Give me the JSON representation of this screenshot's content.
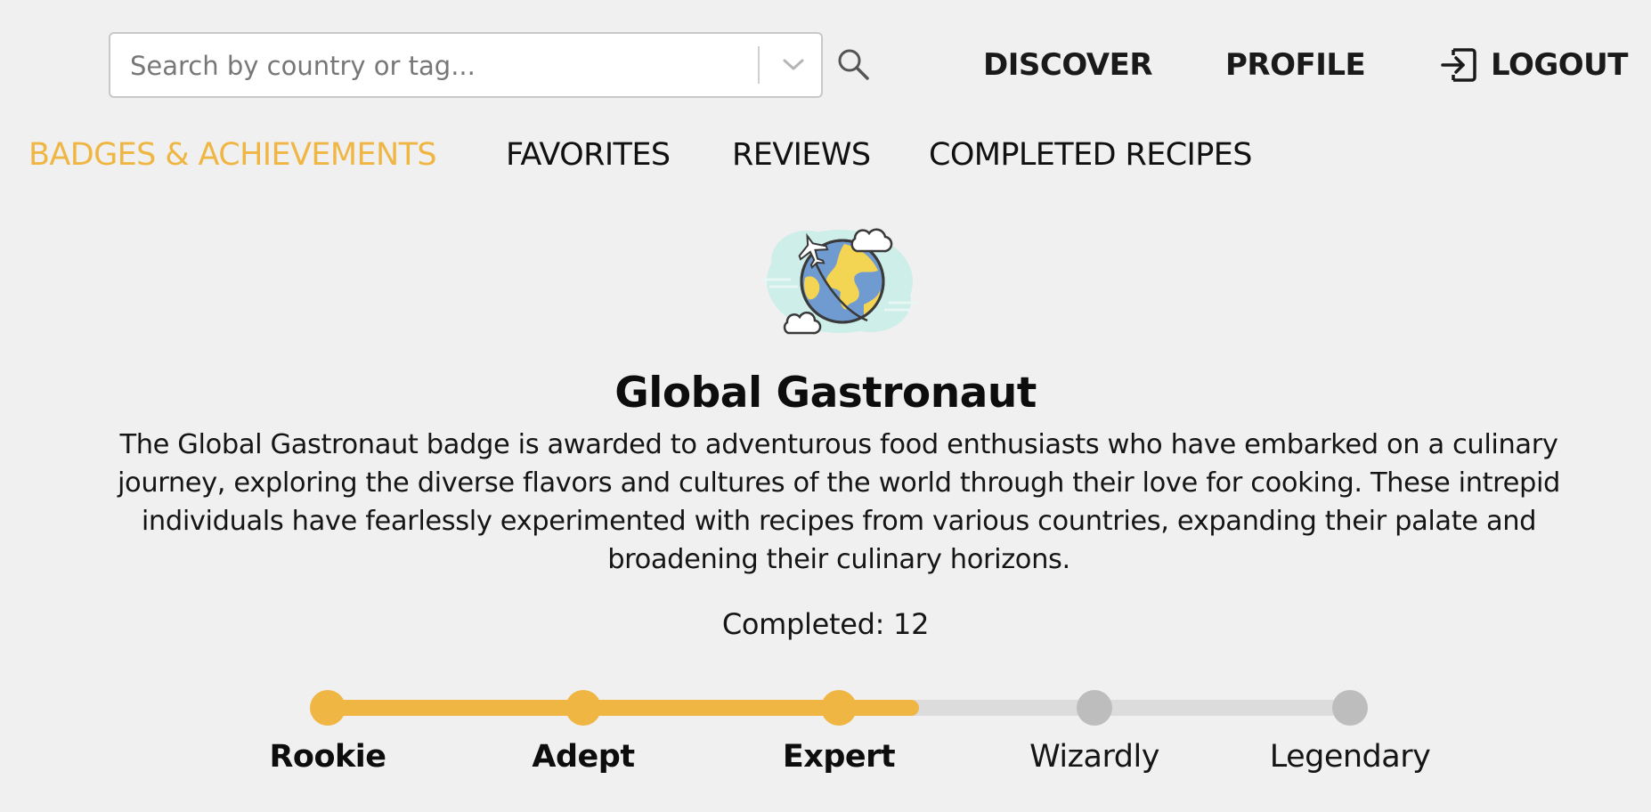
{
  "search": {
    "placeholder": "Search by country or tag...",
    "value": ""
  },
  "nav": {
    "discover": "DISCOVER",
    "profile": "PROFILE",
    "logout": "LOGOUT"
  },
  "tabs": [
    {
      "label": "BADGES & ACHIEVEMENTS",
      "active": true
    },
    {
      "label": "FAVORITES",
      "active": false
    },
    {
      "label": "REVIEWS",
      "active": false
    },
    {
      "label": "COMPLETED RECIPES",
      "active": false
    }
  ],
  "badge": {
    "icon": "globe-airplane-icon",
    "title": "Global Gastronaut",
    "description": "The Global Gastronaut badge is awarded to adventurous food enthusiasts who have embarked on a culinary journey, exploring the diverse flavors and cultures of the world through their love for cooking. These intrepid individuals have fearlessly experimented with recipes from various countries, expanding their palate and broadening their culinary horizons.",
    "completed_text": "Completed: 12"
  },
  "progress": {
    "fraction": 0.58,
    "levels": [
      {
        "label": "Rookie",
        "achieved": true
      },
      {
        "label": "Adept",
        "achieved": true
      },
      {
        "label": "Expert",
        "achieved": true
      },
      {
        "label": "Wizardly",
        "achieved": false
      },
      {
        "label": "Legendary",
        "achieved": false
      }
    ]
  },
  "colors": {
    "accent": "#efb643",
    "inactive": "#bdbdbd",
    "track": "#dcdcdc",
    "background": "#f0f0f0"
  }
}
